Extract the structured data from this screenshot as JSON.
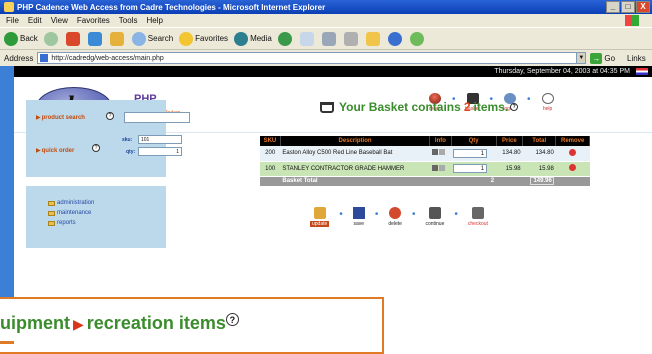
{
  "window": {
    "title": "PHP Cadence Web Access from Cadre Technologies - Microsoft Internet Explorer",
    "controls": [
      "_",
      "□",
      "X"
    ]
  },
  "menu": [
    "File",
    "Edit",
    "View",
    "Favorites",
    "Tools",
    "Help"
  ],
  "toolbar": {
    "back": "Back",
    "search": "Search",
    "favorites": "Favorites",
    "media": "Media"
  },
  "address": {
    "label": "Address",
    "url": "http://cadredg/web-access/main.php",
    "go": "Go",
    "links": "Links"
  },
  "datebar": "Thursday, September 04, 2003 at 04:35 PM",
  "header": {
    "logo": "php",
    "title": "PHP",
    "subtitle": "Fun Cadence Service Modern",
    "nav": [
      "more",
      "basket",
      "logout",
      "help"
    ]
  },
  "search_panel": {
    "product_search_label": "product search",
    "quick_order_label": "quick order",
    "sku_label": "sku:",
    "sku_value": "101",
    "qty_label": "qty:",
    "qty_value": "1",
    "help": "?"
  },
  "admin_panel": {
    "items": [
      "administration",
      "maintenance",
      "reports"
    ]
  },
  "basket": {
    "prefix": "Your Basket contains",
    "count": "2",
    "suffix": "items.",
    "headers": [
      "SKU",
      "Description",
      "Info",
      "Qty",
      "Price",
      "Total",
      "Remove"
    ],
    "rows": [
      {
        "sku": "200",
        "description": "Easton Alloy C500 Red Line Baseball Bat",
        "qty": "1",
        "price": "134.80",
        "total": "134.80"
      },
      {
        "sku": "100",
        "description": "STANLEY CONTRACTOR GRADE HAMMER",
        "qty": "1",
        "price": "15.98",
        "total": "15.98"
      }
    ],
    "total_label": "Basket Total",
    "total_qty": "2",
    "total_value": "149.96"
  },
  "actions": [
    "update",
    "save",
    "delete",
    "continue",
    "checkout"
  ],
  "callout": {
    "text_a": "uipment",
    "text_b": "recreation items",
    "help": "?"
  },
  "colors": {
    "accent_green": "#3a8c2c",
    "accent_orange": "#e07a24",
    "panel_blue": "#bcd9eb",
    "stripe_blue": "#3b7fd6"
  }
}
